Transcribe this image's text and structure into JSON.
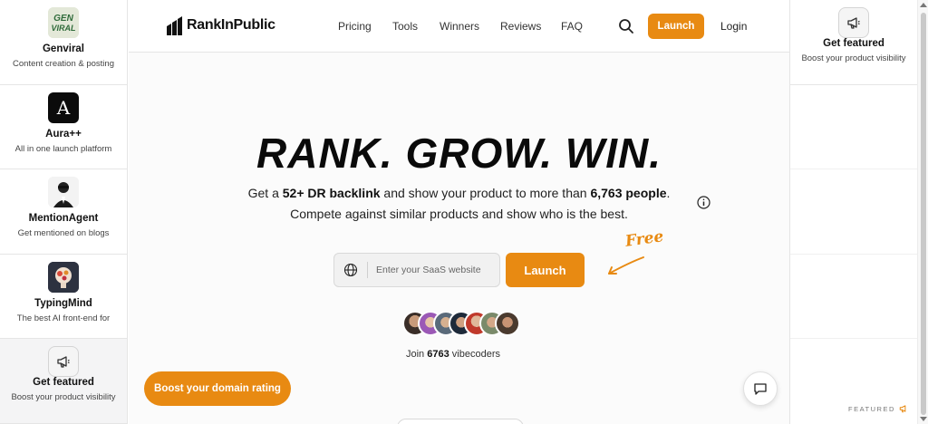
{
  "left_sidebar": {
    "items": [
      {
        "name": "Genviral",
        "desc": "Content creation & posting",
        "logo_text": "GEN VIRAL"
      },
      {
        "name": "Aura++",
        "desc": "All in one launch platform",
        "logo_text": "A"
      },
      {
        "name": "MentionAgent",
        "desc": "Get mentioned on blogs"
      },
      {
        "name": "TypingMind",
        "desc": "The best AI front-end for"
      },
      {
        "name": "Get featured",
        "desc": "Boost your product visibility",
        "icon": "megaphone-icon"
      }
    ]
  },
  "right_sidebar": {
    "featured": {
      "name": "Get featured",
      "desc": "Boost your product visibility",
      "icon": "megaphone-icon"
    },
    "featured_tag": "FEATURED"
  },
  "nav": {
    "brand": "RankInPublic",
    "links": [
      "Pricing",
      "Tools",
      "Winners",
      "Reviews",
      "FAQ"
    ],
    "launch": "Launch",
    "login": "Login"
  },
  "hero": {
    "title": "RANK. GROW. WIN.",
    "line1_a": "Get a ",
    "line1_b": "52+ DR backlink",
    "line1_c": " and show your product to more than ",
    "line1_d": "6,763 people",
    "line1_e": ".",
    "line2": "Compete against similar products and show who is the best.",
    "input_placeholder": "Enter your SaaS website",
    "launch": "Launch",
    "free": "Free",
    "join_a": "Join ",
    "join_count": "6763",
    "join_b": " vibecoders"
  },
  "boost_button": "Boost your domain rating",
  "colors": {
    "accent": "#e88a12",
    "text": "#111111"
  }
}
